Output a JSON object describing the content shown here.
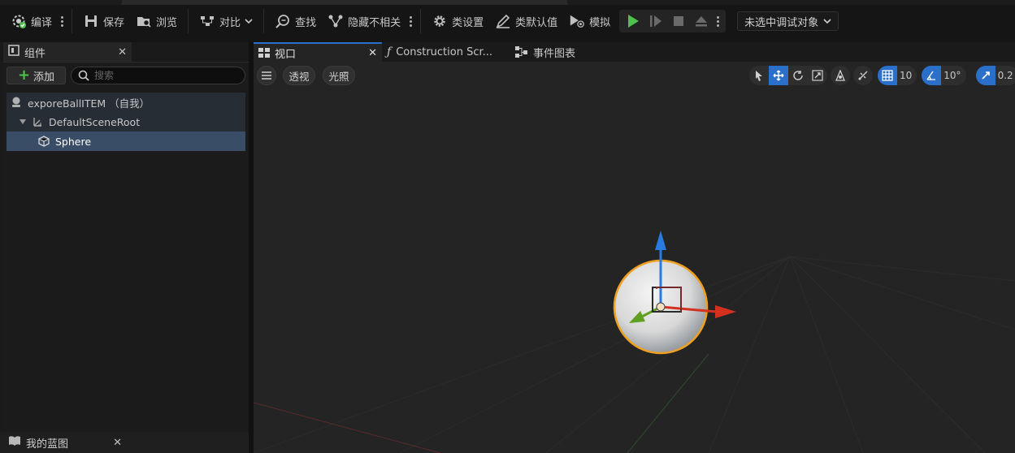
{
  "toolbar": {
    "compile_label": "编译",
    "save_label": "保存",
    "browse_label": "浏览",
    "diff_label": "对比",
    "find_label": "查找",
    "hide_unrelated_label": "隐藏不相关",
    "class_settings_label": "类设置",
    "class_defaults_label": "类默认值",
    "simulate_label": "模拟",
    "debug_object_label": "未选中调试对象"
  },
  "components_panel": {
    "tab_title": "组件",
    "add_label": "添加",
    "search_placeholder": "搜索",
    "tree": {
      "root_label": "exporeBallITEM （自我）",
      "scene_root_label": "DefaultSceneRoot",
      "selected_label": "Sphere"
    }
  },
  "my_blueprint": {
    "tab_title": "我的蓝图"
  },
  "editor_tabs": {
    "viewport": "视口",
    "construction_script": "Construction Scr...",
    "event_graph": "事件图表"
  },
  "viewport_toolbar": {
    "perspective_label": "透视",
    "lighting_label": "光照",
    "grid_snap_value": "10",
    "rotation_snap_value": "10°",
    "scale_snap_value": "0.2"
  },
  "colors": {
    "accent": "#2a6fc9",
    "play_green": "#4fc14f",
    "selection_outline": "#f0a020",
    "axis_x": "#d33020",
    "axis_y": "#5fa020",
    "axis_z": "#2a7be0"
  }
}
